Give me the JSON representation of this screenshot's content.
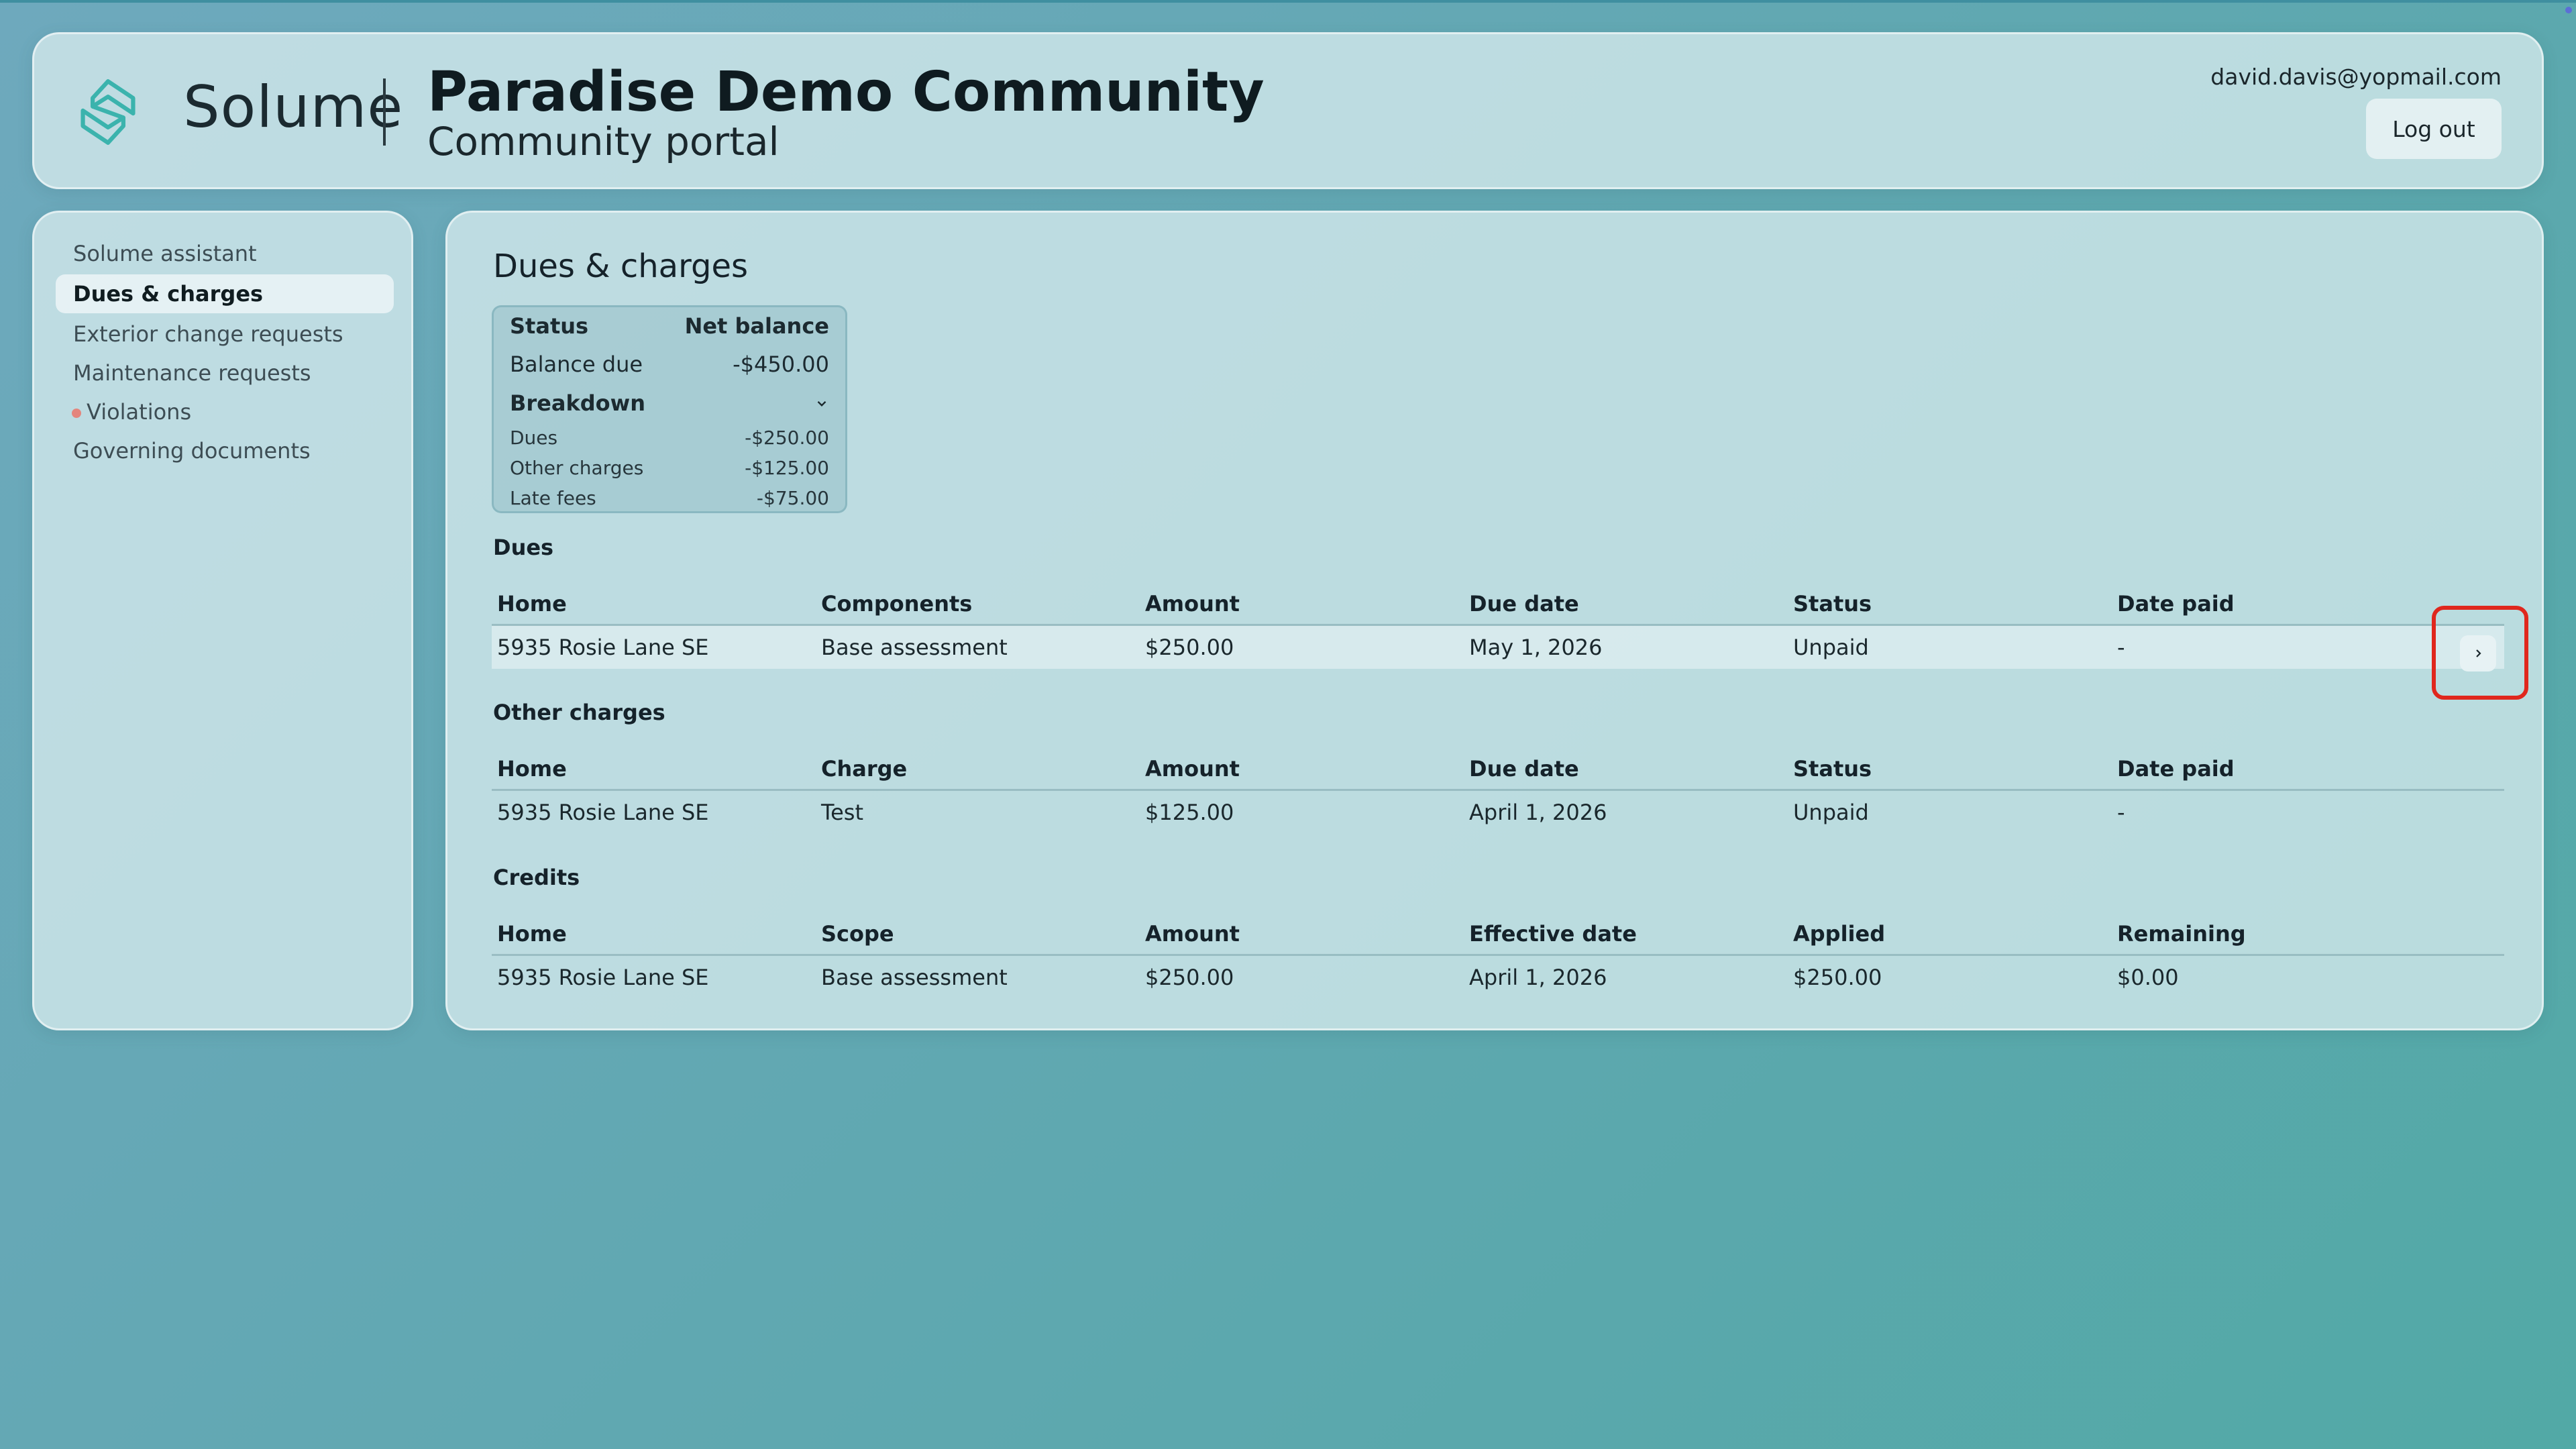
{
  "colors": {
    "accent": "#3bb3ad",
    "alert_dot": "#e4857d",
    "highlight": "#e0271d"
  },
  "header": {
    "brand": "Solume",
    "logo_icon": "solume-logo-icon",
    "title": "Paradise Demo Community",
    "subtitle": "Community portal",
    "user_email": "david.davis@yopmail.com",
    "logout_label": "Log out"
  },
  "sidebar": {
    "items": [
      {
        "label": "Solume assistant",
        "active": false
      },
      {
        "label": "Dues & charges",
        "active": true
      },
      {
        "label": "Exterior change requests",
        "active": false
      },
      {
        "label": "Maintenance requests",
        "active": false
      },
      {
        "label": "Violations",
        "active": false,
        "alert": true
      },
      {
        "label": "Governing documents",
        "active": false
      }
    ]
  },
  "main": {
    "title": "Dues & charges",
    "balance": {
      "status_label": "Status",
      "net_label": "Net balance",
      "due_label": "Balance due",
      "due_value": "-$450.00",
      "breakdown_label": "Breakdown",
      "items": [
        {
          "label": "Dues",
          "value": "-$250.00"
        },
        {
          "label": "Other charges",
          "value": "-$125.00"
        },
        {
          "label": "Late fees",
          "value": "-$75.00"
        }
      ]
    },
    "dues": {
      "title": "Dues",
      "columns": [
        "Home",
        "Components",
        "Amount",
        "Due date",
        "Status",
        "Date paid"
      ],
      "rows": [
        [
          "5935 Rosie Lane SE",
          "Base assessment",
          "$250.00",
          "May 1, 2026",
          "Unpaid",
          "-"
        ]
      ]
    },
    "other": {
      "title": "Other charges",
      "columns": [
        "Home",
        "Charge",
        "Amount",
        "Due date",
        "Status",
        "Date paid"
      ],
      "rows": [
        [
          "5935 Rosie Lane SE",
          "Test",
          "$125.00",
          "April 1, 2026",
          "Unpaid",
          "-"
        ]
      ]
    },
    "credits": {
      "title": "Credits",
      "columns": [
        "Home",
        "Scope",
        "Amount",
        "Effective date",
        "Applied",
        "Remaining"
      ],
      "rows": [
        [
          "5935 Rosie Lane SE",
          "Base assessment",
          "$250.00",
          "April 1, 2026",
          "$250.00",
          "$0.00"
        ]
      ]
    }
  }
}
